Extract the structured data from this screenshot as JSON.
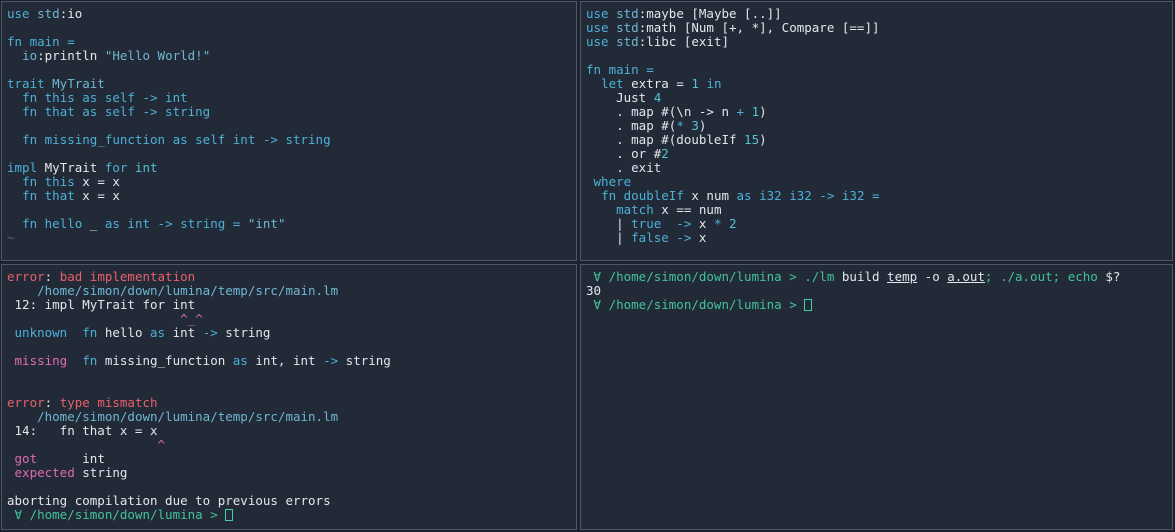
{
  "colors": {
    "background": "#222a38",
    "keyword": "#4db0d6",
    "text": "#e3e6ea",
    "error": "#ea5f6a",
    "prompt": "#43c29a",
    "tilde": "#5c6470"
  },
  "editor_top_left": {
    "lines": [
      [
        [
          "k",
          "use "
        ],
        [
          "s",
          "std"
        ],
        [
          "w",
          ":io"
        ]
      ],
      [],
      [
        [
          "k",
          "fn main ="
        ]
      ],
      [
        [
          "w",
          "  "
        ],
        [
          "s",
          "io"
        ],
        [
          "w",
          ":println "
        ],
        [
          "s",
          "\"Hello World!\""
        ]
      ],
      [],
      [
        [
          "k",
          "trait "
        ],
        [
          "s",
          "MyTrait"
        ]
      ],
      [
        [
          "w",
          "  "
        ],
        [
          "k",
          "fn this as self -> int"
        ]
      ],
      [
        [
          "w",
          "  "
        ],
        [
          "k",
          "fn that as self -> string"
        ]
      ],
      [],
      [
        [
          "w",
          "  "
        ],
        [
          "k",
          "fn missing_function as self int -> string"
        ]
      ],
      [],
      [
        [
          "k",
          "impl "
        ],
        [
          "w",
          "MyTrait "
        ],
        [
          "k",
          "for "
        ],
        [
          "n",
          "int"
        ]
      ],
      [
        [
          "w",
          "  "
        ],
        [
          "k",
          "fn this "
        ],
        [
          "w",
          "x = x"
        ]
      ],
      [
        [
          "w",
          "  "
        ],
        [
          "k",
          "fn that "
        ],
        [
          "w",
          "x = x"
        ]
      ],
      [],
      [
        [
          "w",
          "  "
        ],
        [
          "k",
          "fn hello "
        ],
        [
          "w",
          "_ "
        ],
        [
          "k",
          "as int -> string = "
        ],
        [
          "s",
          "\"int\""
        ]
      ],
      [
        [
          "g",
          "~"
        ]
      ]
    ]
  },
  "editor_top_right": {
    "lines": [
      [
        [
          "k",
          "use "
        ],
        [
          "s",
          "std"
        ],
        [
          "w",
          ":maybe [Maybe [..]]"
        ]
      ],
      [
        [
          "k",
          "use "
        ],
        [
          "s",
          "std"
        ],
        [
          "w",
          ":math [Num [+, *], Compare [==]]"
        ]
      ],
      [
        [
          "k",
          "use "
        ],
        [
          "s",
          "std"
        ],
        [
          "w",
          ":libc [exit]"
        ]
      ],
      [],
      [
        [
          "k",
          "fn main ="
        ]
      ],
      [
        [
          "w",
          "  "
        ],
        [
          "k",
          "let "
        ],
        [
          "w",
          "extra = "
        ],
        [
          "n",
          "1 "
        ],
        [
          "k",
          "in"
        ]
      ],
      [
        [
          "w",
          "    Just "
        ],
        [
          "n",
          "4"
        ]
      ],
      [
        [
          "w",
          "    . map #(\\n -> n "
        ],
        [
          "k",
          "+ "
        ],
        [
          "n",
          "1"
        ],
        [
          "w",
          ")"
        ]
      ],
      [
        [
          "w",
          "    . map #("
        ],
        [
          "k",
          "* "
        ],
        [
          "n",
          "3"
        ],
        [
          "w",
          ")"
        ]
      ],
      [
        [
          "w",
          "    . map #(doubleIf "
        ],
        [
          "n",
          "15"
        ],
        [
          "w",
          ")"
        ]
      ],
      [
        [
          "w",
          "    . or #"
        ],
        [
          "n",
          "2"
        ]
      ],
      [
        [
          "w",
          "    . exit"
        ]
      ],
      [
        [
          "w",
          " "
        ],
        [
          "k",
          "where"
        ]
      ],
      [
        [
          "w",
          "  "
        ],
        [
          "k",
          "fn doubleIf "
        ],
        [
          "w",
          "x num "
        ],
        [
          "k",
          "as i32 i32 -> i32 ="
        ]
      ],
      [
        [
          "w",
          "    "
        ],
        [
          "k",
          "match "
        ],
        [
          "w",
          "x == num"
        ]
      ],
      [
        [
          "w",
          "    | "
        ],
        [
          "k",
          "true  -> "
        ],
        [
          "w",
          "x "
        ],
        [
          "k",
          "* "
        ],
        [
          "n",
          "2"
        ]
      ],
      [
        [
          "w",
          "    | "
        ],
        [
          "k",
          "false -> "
        ],
        [
          "w",
          "x"
        ]
      ]
    ]
  },
  "terminal_bottom_left": {
    "lines": [
      [
        [
          "r",
          "error"
        ],
        [
          "w",
          ": "
        ],
        [
          "r",
          "bad implementation"
        ]
      ],
      [
        [
          "w",
          "    "
        ],
        [
          "s",
          "/home/simon/down/lumina/temp/src/main.lm"
        ]
      ],
      [
        [
          "w",
          " 12: impl MyTrait for int"
        ]
      ],
      [
        [
          "w",
          "                       "
        ],
        [
          "pk",
          "^_^"
        ]
      ],
      [
        [
          "w",
          " "
        ],
        [
          "k",
          "unknown  fn "
        ],
        [
          "w",
          "hello "
        ],
        [
          "k",
          "as "
        ],
        [
          "w",
          "int "
        ],
        [
          "k",
          "-> "
        ],
        [
          "w",
          "string"
        ]
      ],
      [],
      [
        [
          "w",
          " "
        ],
        [
          "pk",
          "missing  "
        ],
        [
          "k",
          "fn "
        ],
        [
          "w",
          "missing_function "
        ],
        [
          "k",
          "as "
        ],
        [
          "w",
          "int, int "
        ],
        [
          "k",
          "-> "
        ],
        [
          "w",
          "string"
        ]
      ],
      [],
      [],
      [
        [
          "r",
          "error"
        ],
        [
          "w",
          ": "
        ],
        [
          "r",
          "type mismatch"
        ]
      ],
      [
        [
          "w",
          "    "
        ],
        [
          "s",
          "/home/simon/down/lumina/temp/src/main.lm"
        ]
      ],
      [
        [
          "w",
          " 14:   fn that x = x"
        ]
      ],
      [
        [
          "w",
          "                    "
        ],
        [
          "pk",
          "^"
        ]
      ],
      [
        [
          "w",
          " "
        ],
        [
          "pk",
          "got      "
        ],
        [
          "w",
          "int"
        ]
      ],
      [
        [
          "w",
          " "
        ],
        [
          "pk",
          "expected "
        ],
        [
          "w",
          "string"
        ]
      ],
      [],
      [
        [
          "w",
          "aborting compilation due to previous errors"
        ]
      ],
      [
        [
          "grn",
          " ∀ /home/simon/down/lumina > "
        ],
        [
          "cur",
          ""
        ]
      ]
    ]
  },
  "terminal_bottom_right": {
    "lines": [
      [
        [
          "grn",
          " ∀ /home/simon/down/lumina > "
        ],
        [
          "grn",
          "./lm "
        ],
        [
          "w",
          "build "
        ],
        [
          "wu",
          "temp"
        ],
        [
          "w",
          " -o "
        ],
        [
          "wu",
          "a.out"
        ],
        [
          "grn",
          "; ./a.out; echo "
        ],
        [
          "w",
          "$?"
        ]
      ],
      [
        [
          "w",
          "30"
        ]
      ],
      [
        [
          "grn",
          " ∀ /home/simon/down/lumina > "
        ],
        [
          "cur",
          ""
        ]
      ]
    ]
  }
}
